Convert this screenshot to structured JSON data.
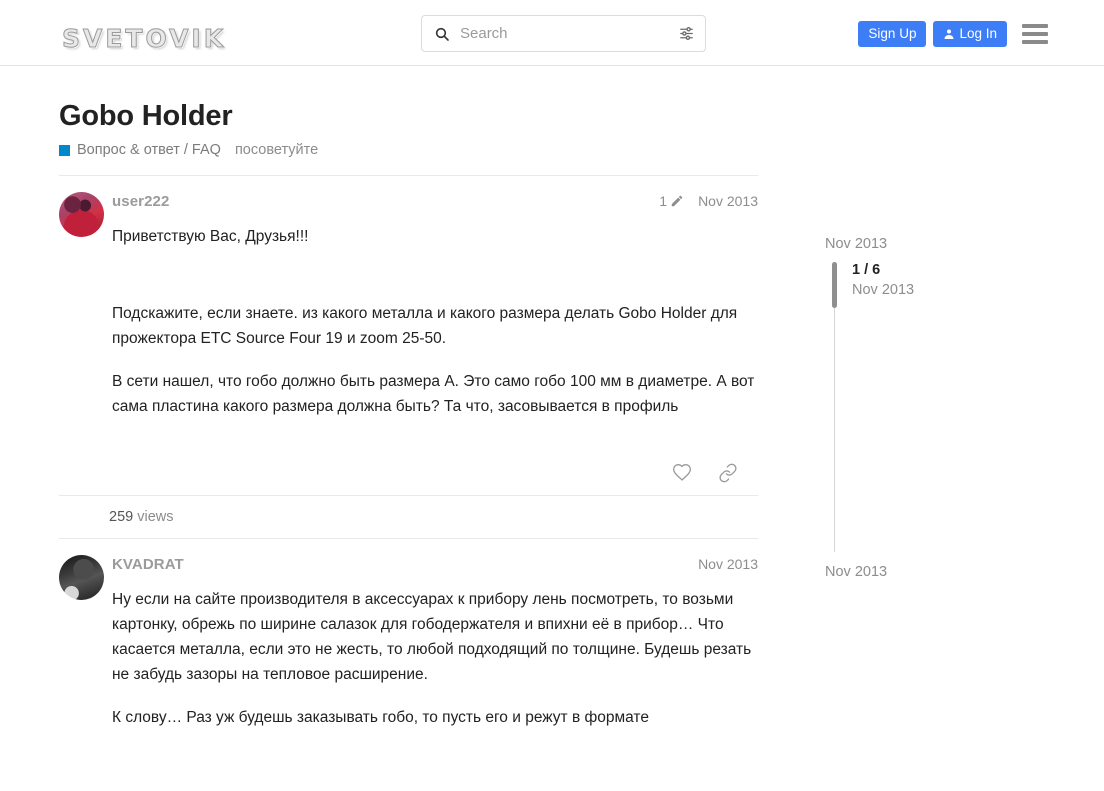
{
  "header": {
    "logo_text": "SVETOVIK",
    "search": {
      "placeholder": "Search",
      "value": "",
      "search_icon": "search-icon",
      "filter_icon": "filter-sliders-icon"
    },
    "sign_up_label": "Sign Up",
    "log_in_label": "Log In",
    "menu_icon": "hamburger-menu-icon",
    "accent_color": "#3d7ef7"
  },
  "topic": {
    "title": "Gobo Holder",
    "category": "Вопрос & ответ / FAQ",
    "category_color": "#0088cc",
    "tag": "посоветуйте"
  },
  "posts": [
    {
      "author": "user222",
      "edit_count": "1",
      "edit_icon": "pencil-icon",
      "date": "Nov 2013",
      "paragraphs": [
        "Приветствую Вас, Друзья!!!",
        "Подскажите, если знаете. из какого металла и какого размера делать Gobo Holder для прожектора ETC Source Four 19 и zoom 25-50.",
        "В сети нашел, что гобо должно быть размера А. Это само гобо 100 мм в диаметре. А вот сама пластина какого размера должна быть? Та что, засовывается в профиль"
      ],
      "actions": {
        "like_icon": "heart-icon",
        "share_icon": "link-icon"
      }
    },
    {
      "author": "KVADRAT",
      "date": "Nov 2013",
      "paragraphs": [
        "Ну если на сайте производителя в аксессуарах к прибору лень посмотреть, то возьми картонку, обрежь по ширине салазок для гободержателя  и впихни её в прибор…  Что касается металла, если это не жесть, то любой подходящий по толщине. Будешь резать не забудь зазоры на тепловое расширение.",
        "К слову… Раз уж будешь заказывать гобо, то пусть его и режут в формате"
      ]
    }
  ],
  "views": {
    "count": "259",
    "label": "views"
  },
  "timeline": {
    "top_date": "Nov 2013",
    "position": "1 / 6",
    "position_date": "Nov 2013",
    "bottom_date": "Nov 2013"
  }
}
